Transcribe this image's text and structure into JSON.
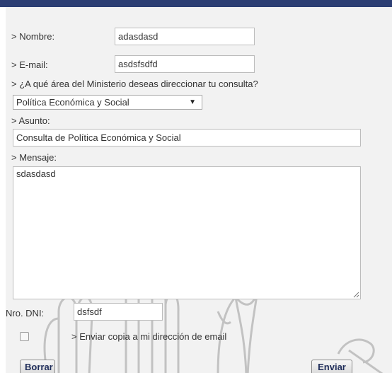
{
  "form": {
    "nombre_label": "> Nombre:",
    "nombre_value": "adasdasd",
    "email_label": "> E-mail:",
    "email_value": "asdsfsdfd",
    "area_question": "> ¿A qué área del Ministerio deseas direccionar tu consulta?",
    "area_selected": "Política Económica y Social",
    "asunto_label": "> Asunto:",
    "asunto_value": "Consulta de Política Económica y Social",
    "mensaje_label": "> Mensaje:",
    "mensaje_value": "sdasdasd",
    "dni_label": "Nro. DNI:",
    "dni_value": "dsfsdf",
    "copy_label": "> Enviar copia a mi dirección de email",
    "copy_checked": false
  },
  "buttons": {
    "borrar": "Borrar",
    "enviar": "Enviar"
  },
  "icons": {
    "dropdown": "triangle-down",
    "watermark": "hands-and-flowers-emblem"
  },
  "colors": {
    "header_bar": "#2c3e73",
    "panel_background": "#f2f2f2",
    "button_text": "#1f2d5a"
  }
}
